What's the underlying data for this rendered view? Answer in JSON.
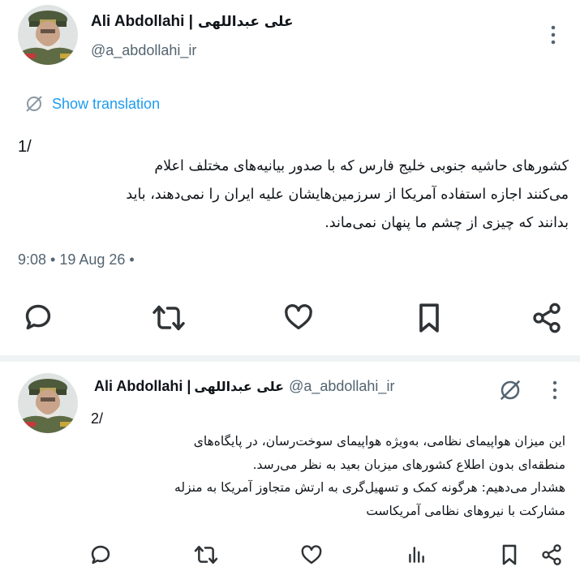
{
  "tweet1": {
    "author_name": "Ali Abdollahi |",
    "author_name_fa": "علی عبداللهی",
    "handle": "@a_abdollahi_ir",
    "translate_label": "Show translation",
    "thread_number": "1/",
    "body_lines": [
      "کشورهای حاشیه جنوبی خلیج فارس که با صدور بیانیه‌های مختلف اعلام",
      "می‌کنند اجازه استفاده آمریکا از سرزمین‌هایشان علیه ایران را نمی‌دهند، باید",
      "بدانند که چیزی از چشم ما پنهان نمی‌ماند."
    ],
    "timestamp": "9:08 • 19 Aug 26 •"
  },
  "tweet2": {
    "author_name": "Ali Abdollahi |",
    "author_name_fa": "علی عبداللهی",
    "handle": "@a_abdollahi_ir",
    "thread_number": "2/",
    "body_lines": [
      "این میزان هواپیمای نظامی، به‌ویژه هواپیمای سوخت‌رسان، در پایگاه‌های",
      "منطقه‌ای بدون اطلاع کشورهای میزبان بعید به نظر می‌رسد.",
      "هشدار می‌دهیم: هرگونه کمک و تسهیل‌گری به ارتش متجاوز آمریکا به منزله",
      "مشارکت با نیروهای نظامی آمریکاست"
    ]
  },
  "icons": {
    "reply": "reply-icon",
    "retweet": "retweet-icon",
    "like": "like-icon",
    "views": "views-icon",
    "bookmark": "bookmark-icon",
    "share": "share-icon",
    "more": "more-vertical-icon",
    "translate": "translate-icon"
  },
  "colors": {
    "accent": "#1d9bf0",
    "secondary_text": "#536471",
    "icon": "#2f3336",
    "separator": "#eff3f4"
  }
}
